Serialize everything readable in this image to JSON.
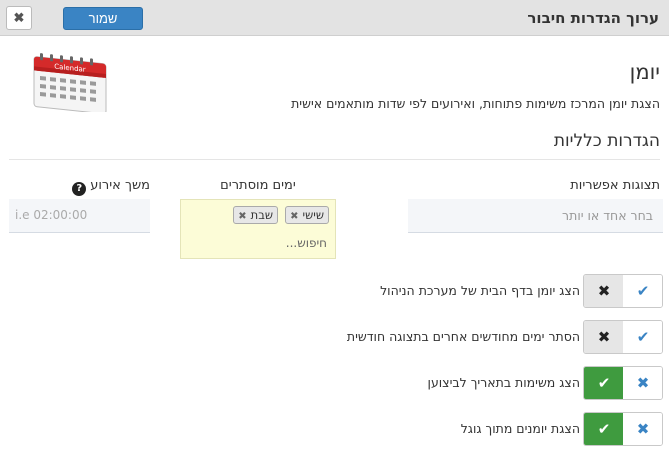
{
  "header": {
    "title": "ערוך הגדרות חיבור",
    "save_label": "שמור",
    "close_glyph": "✖"
  },
  "page": {
    "title": "יומן",
    "description": "הצגת יומן המרכז משימות פתוחות, ואירועים לפי שדות מותאמים אישית",
    "section_title": "הגדרות כלליות",
    "icon": "calendar-icon",
    "icon_text": "Calendar"
  },
  "fields": {
    "views": {
      "label": "תצוגות אפשריות",
      "placeholder": "בחר אחד או יותר"
    },
    "hidden_days": {
      "label": "ימים מוסתרים",
      "tags": [
        "שישי",
        "שבת"
      ],
      "search_placeholder": "חיפוש..."
    },
    "duration": {
      "label": "משך אירוע",
      "placeholder": "i.e 02:00:00",
      "help_glyph": "?"
    }
  },
  "toggles": [
    {
      "label": "הצג יומן בדף הבית של מערכת הניהול",
      "on": false
    },
    {
      "label": "הסתר ימים מחודשים אחרים בתצוגה חודשית",
      "on": false
    },
    {
      "label": "הצג משימות בתאריך לביצוען",
      "on": true
    },
    {
      "label": "הצגת יומנים מתוך גוגל",
      "on": true
    }
  ],
  "colors": {
    "primary": "#3a84c4",
    "success": "#3f9b3f",
    "tags_background": "#fcfcd7",
    "calendar_red": "#d42a2a"
  }
}
